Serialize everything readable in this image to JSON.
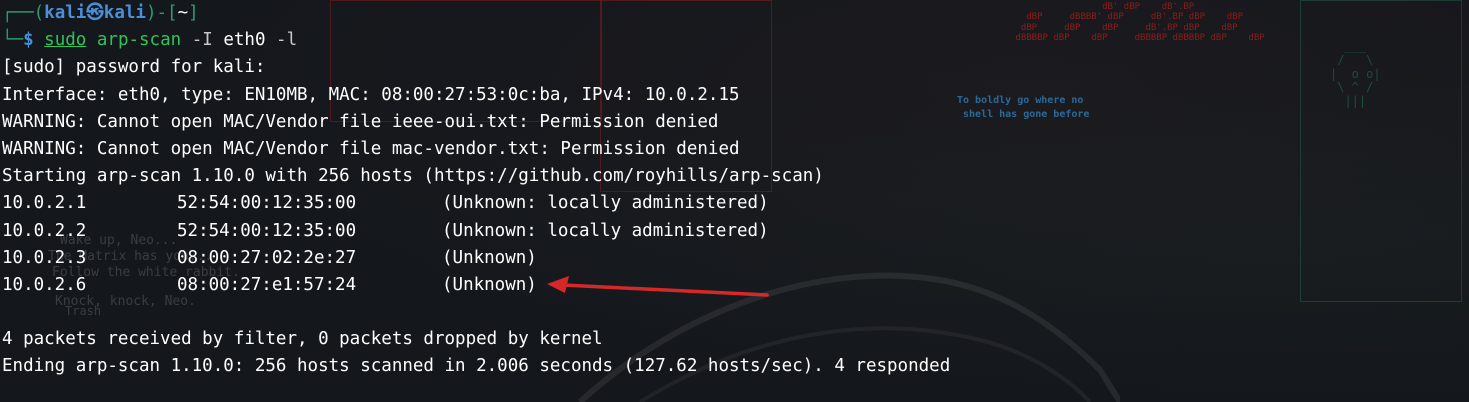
{
  "prompt": {
    "frame_top": "┌──(",
    "user_host": "kali㉿kali",
    "sep": ")-[",
    "dir": "~",
    "close": "]",
    "frame_bottom": "└─",
    "dollar": "$",
    "cmd_sudo": "sudo",
    "cmd_bin": "arp-scan",
    "cmd_flag_i": "-I",
    "cmd_iface": "eth0",
    "cmd_flag_l": "-l"
  },
  "output": {
    "sudo_prompt": "[sudo] password for kali:",
    "interface": "Interface: eth0, type: EN10MB, MAC: 08:00:27:53:0c:ba, IPv4: 10.0.2.15",
    "warning1": "WARNING: Cannot open MAC/Vendor file ieee-oui.txt: Permission denied",
    "warning2": "WARNING: Cannot open MAC/Vendor file mac-vendor.txt: Permission denied",
    "starting": "Starting arp-scan 1.10.0 with 256 hosts (https://github.com/royhills/arp-scan)",
    "hosts": [
      {
        "ip": "10.0.2.1",
        "mac": "52:54:00:12:35:00",
        "vendor": "(Unknown: locally administered)"
      },
      {
        "ip": "10.0.2.2",
        "mac": "52:54:00:12:35:00",
        "vendor": "(Unknown: locally administered)"
      },
      {
        "ip": "10.0.2.3",
        "mac": "08:00:27:02:2e:27",
        "vendor": "(Unknown)"
      },
      {
        "ip": "10.0.2.6",
        "mac": "08:00:27:e1:57:24",
        "vendor": "(Unknown)"
      }
    ],
    "packets": "4 packets received by filter, 0 packets dropped by kernel",
    "ending": "Ending arp-scan 1.10.0: 256 hosts scanned in 2.006 seconds (127.62 hosts/sec). 4 responded"
  },
  "wallpaper": {
    "tagline_1": "To boldly go where no",
    "tagline_2": "shell has gone before",
    "matrix_1": "Wake up, Neo...",
    "matrix_2": "The Matrix has you...",
    "matrix_3": "Follow the white rabbit.",
    "matrix_4": "Knock, knock, Neo.",
    "desktop_icon": "Trash"
  },
  "colors": {
    "background": "#14171c",
    "prompt_frame": "#2b9c6d",
    "prompt_user": "#4a8fd8",
    "command": "#2fc45a",
    "arrow": "#d62828"
  }
}
